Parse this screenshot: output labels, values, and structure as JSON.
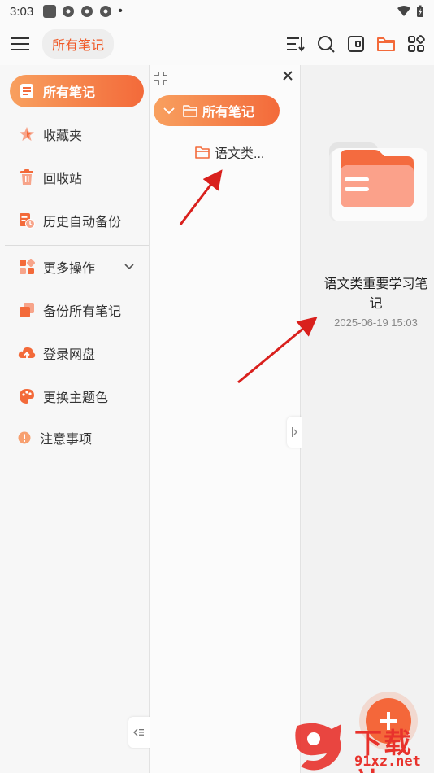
{
  "status_bar": {
    "time": "3:03"
  },
  "toolbar": {
    "breadcrumb": "所有笔记"
  },
  "sidebar": {
    "items": [
      {
        "label": "所有笔记"
      },
      {
        "label": "收藏夹"
      },
      {
        "label": "回收站"
      },
      {
        "label": "历史自动备份"
      },
      {
        "label": "更多操作"
      },
      {
        "label": "备份所有笔记"
      },
      {
        "label": "登录网盘"
      },
      {
        "label": "更换主题色"
      },
      {
        "label": "注意事项"
      }
    ]
  },
  "folder_panel": {
    "root_label": "所有笔记",
    "child_label": "语文类..."
  },
  "content": {
    "note": {
      "title": "语文类重要学习笔记",
      "date": "2025-06-19 15:03"
    }
  },
  "watermark": {
    "text_cn": "下载站",
    "text_domain": "91xz.net"
  },
  "colors": {
    "accent": "#f36a3a",
    "accent_light": "#f8a05f",
    "arrow": "#d9201d"
  }
}
